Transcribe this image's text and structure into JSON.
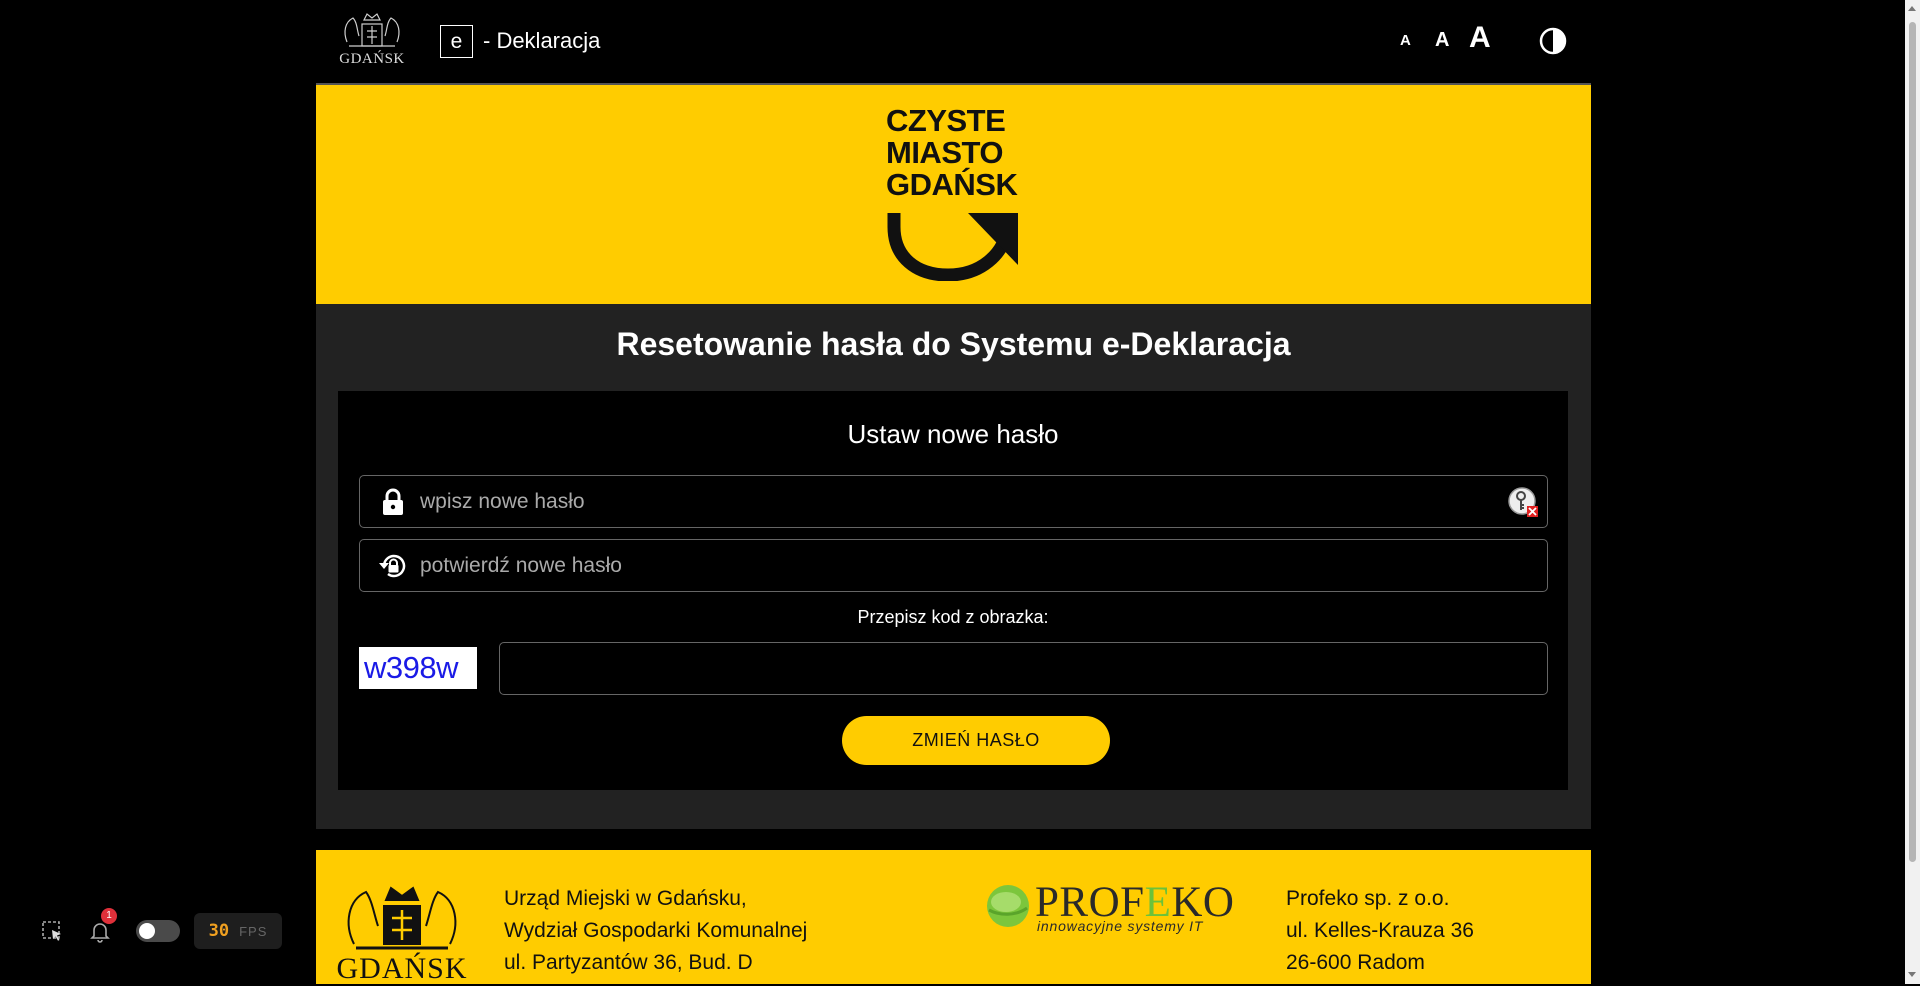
{
  "header": {
    "city_logo_text": "GDAŃSK",
    "app_prefix": "e",
    "app_title": "- Deklaracja",
    "font_small": "A",
    "font_medium": "A",
    "font_large": "A",
    "contrast_icon": "contrast-icon"
  },
  "banner": {
    "logo_lines": [
      "CZYSTE",
      "MIASTO",
      "GDAŃSK"
    ]
  },
  "main": {
    "title": "Resetowanie hasła do Systemu e-Deklaracja",
    "card_title": "Ustaw nowe hasło",
    "new_password": {
      "placeholder": "wpisz nowe hasło",
      "value": "",
      "icon": "lock-icon",
      "toggle_icon": "show-password-icon"
    },
    "confirm_password": {
      "placeholder": "potwierdź nowe hasło",
      "value": "",
      "icon": "lock-reset-icon"
    },
    "captcha_label": "Przepisz kod z obrazka:",
    "captcha_code": "w398w",
    "captcha_value": "",
    "submit_label": "ZMIEŃ HASŁO"
  },
  "footer": {
    "city_logo_text": "GDAŃSK",
    "address_1": [
      "Urząd Miejski w Gdańsku,",
      "Wydział Gospodarki Komunalnej",
      "ul. Partyzantów 36, Bud. D"
    ],
    "partner_name_pre": "PROF",
    "partner_name_e": "E",
    "partner_name_post": "KO",
    "partner_tagline": "innowacyjne systemy IT",
    "address_2": [
      "Profeko sp. z o.o.",
      "ul. Kelles-Krauza 36",
      "26-600 Radom"
    ]
  },
  "overlay": {
    "notification_count": "1",
    "fps_value": "30",
    "fps_label": "FPS"
  },
  "colors": {
    "accent_yellow": "#ffcc00",
    "background": "#000000",
    "panel": "#222222",
    "captcha_text": "#1a1ae6"
  }
}
